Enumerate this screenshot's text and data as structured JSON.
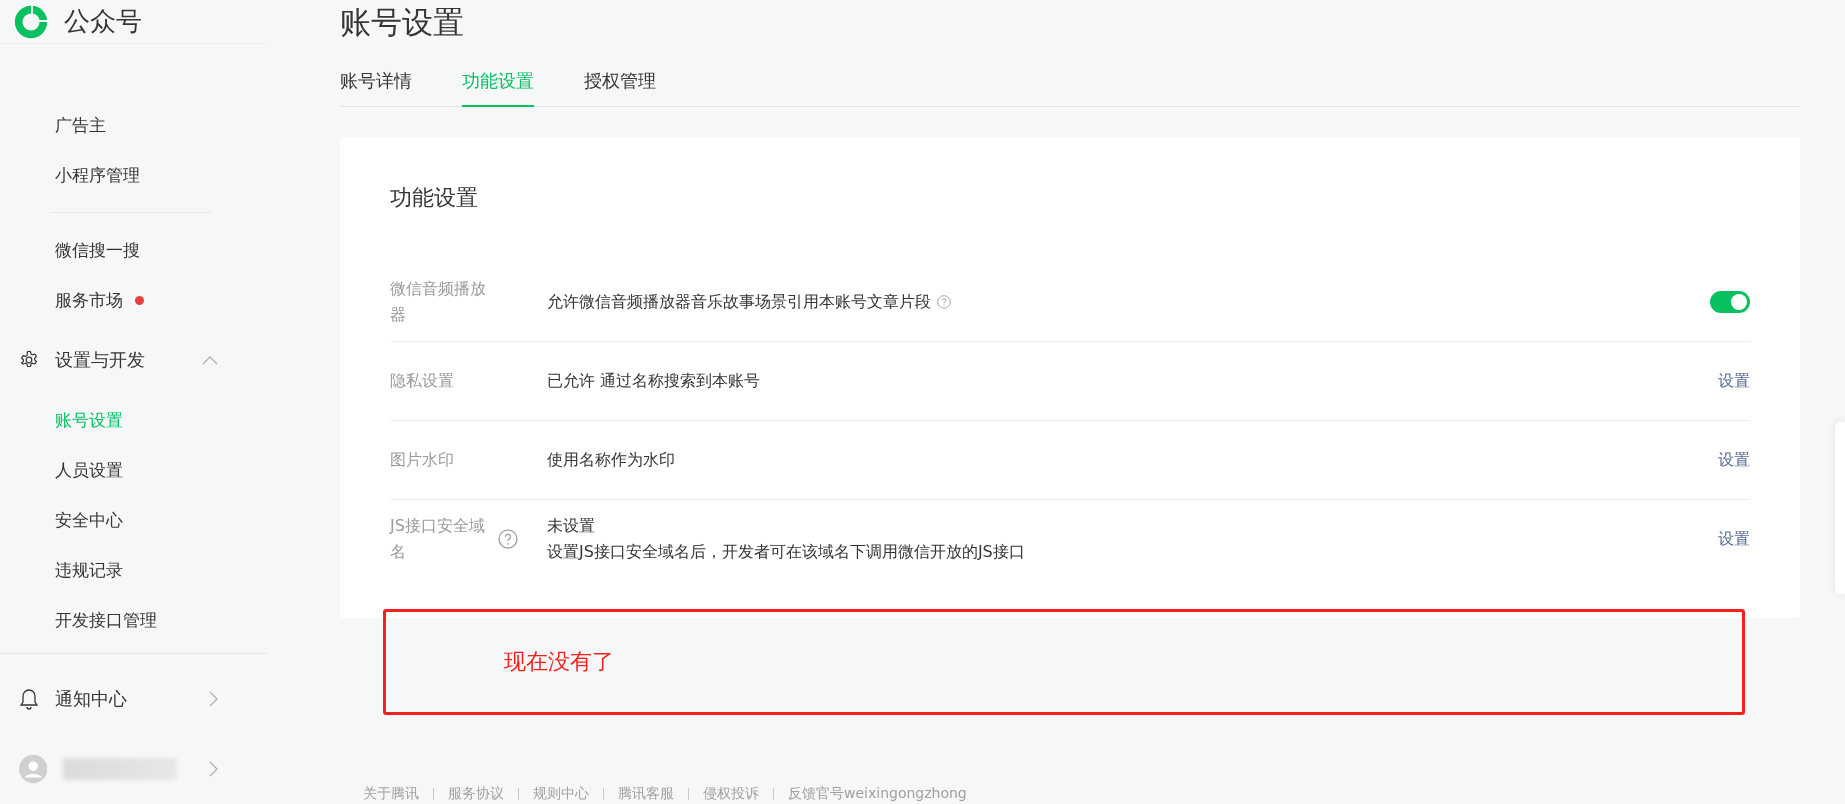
{
  "brand": {
    "name": "公众号"
  },
  "sidebar": {
    "items": [
      {
        "kind": "item",
        "label": "广告主",
        "selected": false
      },
      {
        "kind": "item",
        "label": "小程序管理",
        "selected": false
      },
      {
        "kind": "divider"
      },
      {
        "kind": "item",
        "label": "微信搜一搜",
        "selected": false
      },
      {
        "kind": "item",
        "label": "服务市场",
        "selected": false,
        "color": "#e5403b"
      },
      {
        "kind": "group",
        "label": "设置与开发",
        "expanded": true
      },
      {
        "kind": "item",
        "label": "账号设置",
        "selected": true
      },
      {
        "kind": "item",
        "label": "人员设置",
        "selected": false
      },
      {
        "kind": "item",
        "label": "安全中心",
        "selected": false
      },
      {
        "kind": "item",
        "label": "违规记录",
        "selected": false
      },
      {
        "kind": "item",
        "label": "开发接口管理",
        "selected": false
      },
      {
        "kind": "divider"
      },
      {
        "kind": "group",
        "label": "通知中心",
        "expanded": false
      },
      {
        "kind": "account",
        "expanded": false
      }
    ]
  },
  "page": {
    "title": "账号设置"
  },
  "tabs": [
    {
      "label": "账号详情",
      "selected": false
    },
    {
      "label": "功能设置",
      "selected": true
    },
    {
      "label": "授权管理",
      "selected": false
    }
  ],
  "card": {
    "title": "功能设置",
    "rows": [
      {
        "kind": "toggle",
        "label": "微信音频播放器",
        "value": "允许微信音频播放器音乐故事场景引用本账号文章片段",
        "help": true,
        "on": true
      },
      {
        "kind": "link",
        "label": "隐私设置",
        "value": "已允许 通过名称搜索到本账号",
        "action": "设置"
      },
      {
        "kind": "link",
        "label": "图片水印",
        "value": "使用名称作为水印",
        "action": "设置"
      },
      {
        "kind": "link",
        "label": "JS接口安全域名",
        "label_help": true,
        "value": "未设置",
        "note": "设置JS接口安全域名后，开发者可在该域名下调用微信开放的JS接口",
        "action": "设置"
      }
    ]
  },
  "annotation": {
    "text": "现在没有了"
  },
  "footer": {
    "links": [
      "关于腾讯",
      "服务协议",
      "规则中心",
      "腾讯客服",
      "侵权投诉",
      "反馈官号weixingongzhong"
    ]
  }
}
